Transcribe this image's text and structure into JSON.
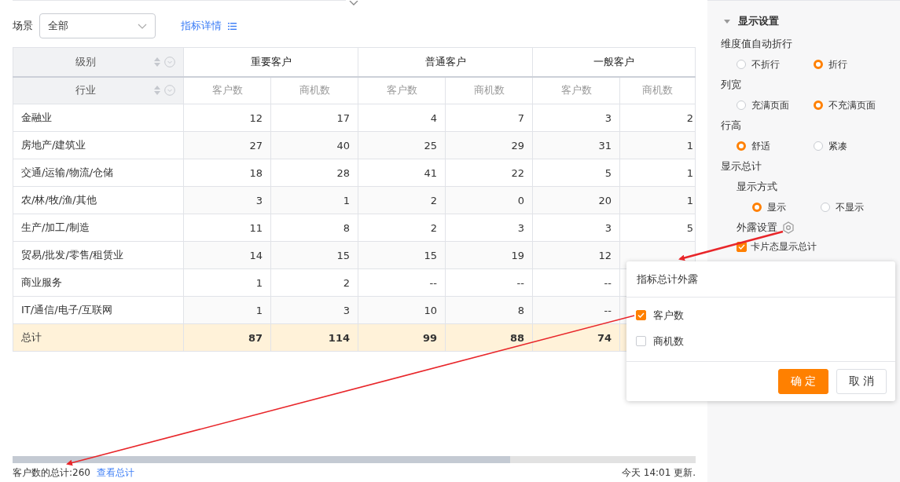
{
  "filter": {
    "label": "场景",
    "value": "全部"
  },
  "details_link": "指标详情",
  "table": {
    "corner_headers": [
      "级别",
      "行业"
    ],
    "groups": [
      "重要客户",
      "普通客户",
      "一般客户"
    ],
    "metrics": [
      "客户数",
      "商机数",
      "客户数",
      "商机数",
      "客户数",
      "商机数"
    ],
    "rows": [
      {
        "label": "金融业",
        "cells": [
          "12",
          "17",
          "4",
          "7",
          "3",
          "2"
        ]
      },
      {
        "label": "房地产/建筑业",
        "cells": [
          "27",
          "40",
          "25",
          "29",
          "31",
          "1"
        ]
      },
      {
        "label": "交通/运输/物流/仓储",
        "cells": [
          "18",
          "28",
          "41",
          "22",
          "5",
          "1"
        ]
      },
      {
        "label": "农/林/牧/渔/其他",
        "cells": [
          "3",
          "1",
          "2",
          "0",
          "20",
          "1"
        ]
      },
      {
        "label": "生产/加工/制造",
        "cells": [
          "11",
          "8",
          "2",
          "3",
          "3",
          "5"
        ]
      },
      {
        "label": "贸易/批发/零售/租赁业",
        "cells": [
          "14",
          "15",
          "15",
          "19",
          "12",
          null
        ]
      },
      {
        "label": "商业服务",
        "cells": [
          "1",
          "2",
          "--",
          "--",
          "--",
          null
        ]
      },
      {
        "label": "IT/通信/电子/互联网",
        "cells": [
          "1",
          "3",
          "10",
          "8",
          "--",
          null
        ]
      }
    ],
    "total": {
      "label": "总计",
      "cells": [
        "87",
        "114",
        "99",
        "88",
        "74",
        null
      ]
    }
  },
  "footer": {
    "total_text": "客户数的总计:260",
    "link": "查看总计",
    "updated": "今天 14:01 更新."
  },
  "settings": {
    "title": "显示设置",
    "expanded": true,
    "groups": [
      {
        "label": "维度值自动折行",
        "options": [
          {
            "label": "不折行",
            "selected": false
          },
          {
            "label": "折行",
            "selected": true
          }
        ]
      },
      {
        "label": "列宽",
        "options": [
          {
            "label": "充满页面",
            "selected": false
          },
          {
            "label": "不充满页面",
            "selected": true
          }
        ]
      },
      {
        "label": "行高",
        "options": [
          {
            "label": "舒适",
            "selected": true
          },
          {
            "label": "紧凑",
            "selected": false
          }
        ]
      }
    ],
    "total_section": {
      "label": "显示总计",
      "mode_label": "显示方式",
      "modes": [
        {
          "label": "显示",
          "selected": true
        },
        {
          "label": "不显示",
          "selected": false
        }
      ],
      "exposure_label": "外露设置",
      "card_total": {
        "label": "卡片态显示总计",
        "checked": true
      }
    }
  },
  "popup": {
    "title": "指标总计外露",
    "options": [
      {
        "label": "客户数",
        "checked": true
      },
      {
        "label": "商机数",
        "checked": false
      }
    ],
    "buttons": [
      {
        "label": "确 定",
        "kind": "primary"
      },
      {
        "label": "取 消",
        "kind": "default"
      }
    ]
  }
}
